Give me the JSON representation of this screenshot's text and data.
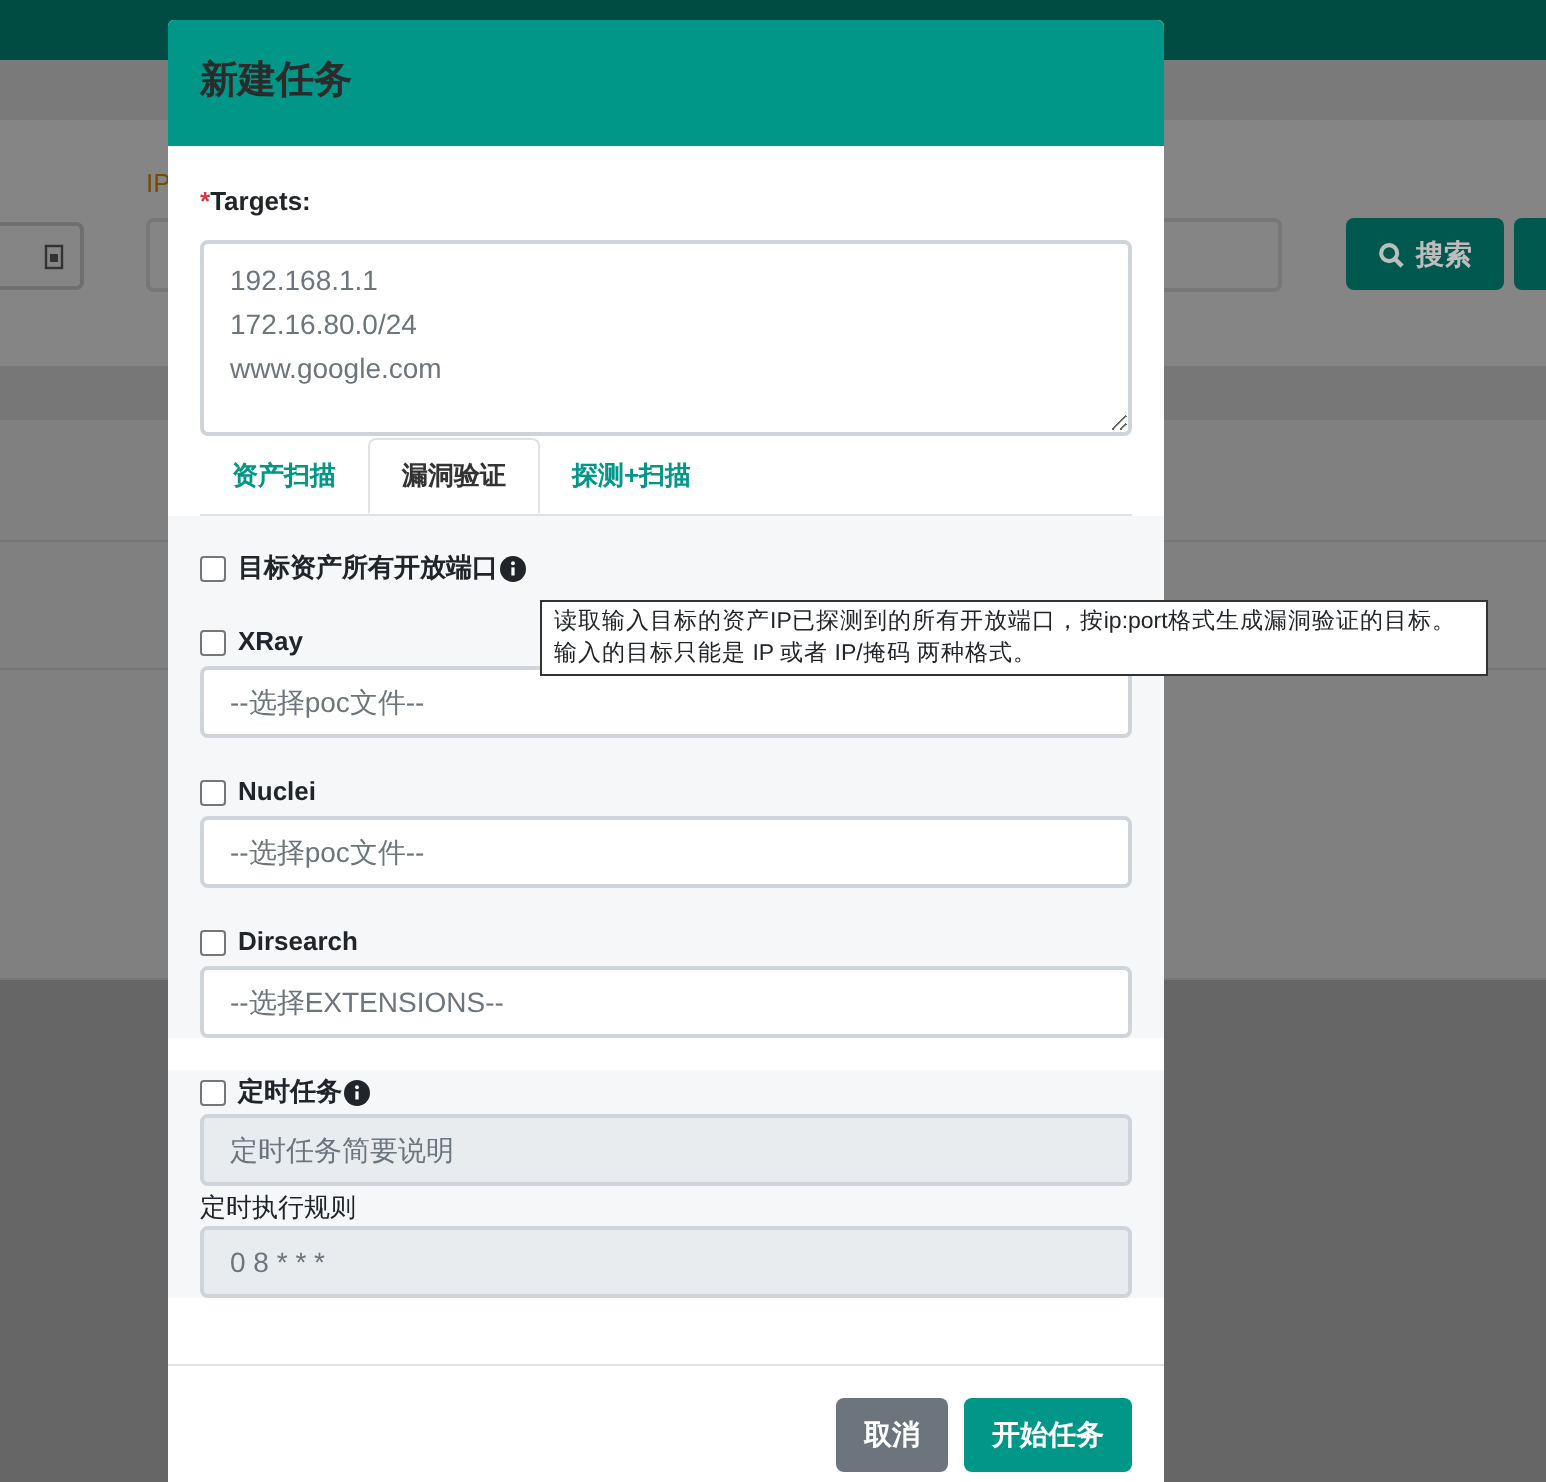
{
  "background": {
    "field_label": "IP",
    "search_button": "搜索"
  },
  "dialog": {
    "title": "新建任务",
    "targets": {
      "required_mark": "*",
      "label": "Targets:",
      "placeholder": "192.168.1.1\n172.16.80.0/24\nwww.google.com"
    },
    "tabs": [
      {
        "label": "资产扫描",
        "selected": false
      },
      {
        "label": "漏洞验证",
        "selected": true
      },
      {
        "label": "探测+扫描",
        "selected": false
      }
    ],
    "options": [
      {
        "kind": "checkbox",
        "label": "目标资产所有开放端口",
        "checked": false,
        "info": true
      },
      {
        "kind": "select",
        "label": "XRay",
        "checked": false,
        "placeholder": "--选择poc文件--"
      },
      {
        "kind": "select",
        "label": "Nuclei",
        "checked": false,
        "placeholder": "--选择poc文件--"
      },
      {
        "kind": "select",
        "label": "Dirsearch",
        "checked": false,
        "placeholder": "--选择EXTENSIONS--"
      }
    ],
    "schedule": {
      "label": "定时任务",
      "checked": false,
      "info": true,
      "description_placeholder": "定时任务简要说明",
      "rule_label": "定时执行规则",
      "rule_placeholder": "0 8 * * *"
    },
    "tooltip": {
      "lines": [
        "读取输入目标的资产IP已探测到的所有开放端口，按ip:port格式生成漏洞验证的目标。",
        "输入的目标只能是 IP 或者 IP/掩码 两种格式。"
      ]
    },
    "buttons": [
      {
        "label": "取消",
        "kind": "secondary"
      },
      {
        "label": "开始任务",
        "kind": "primary"
      }
    ]
  }
}
